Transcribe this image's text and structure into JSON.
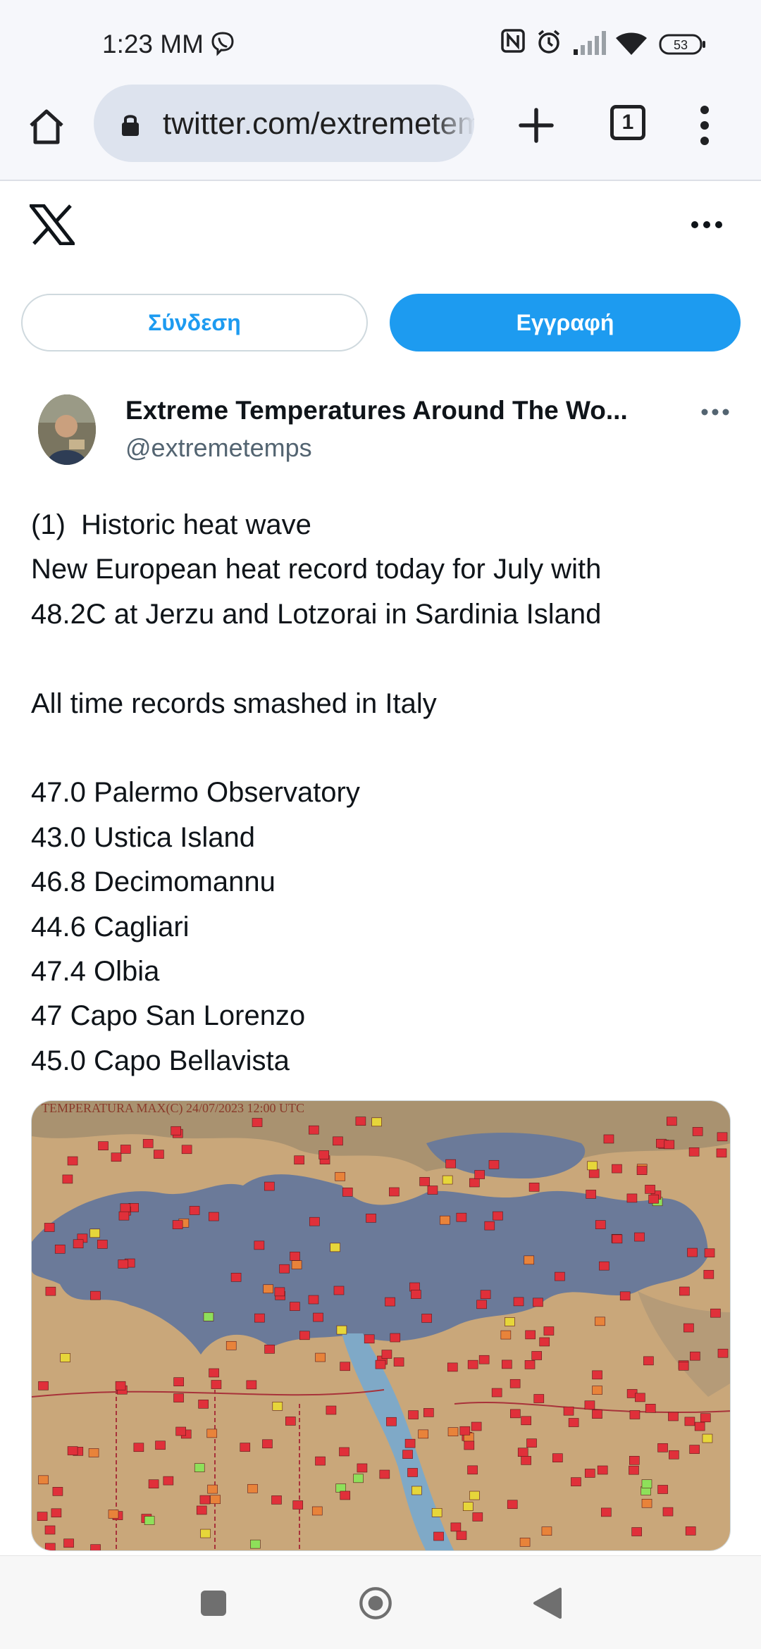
{
  "status_bar": {
    "time": "1:23 MM",
    "battery": "53"
  },
  "browser": {
    "url": "twitter.com/extremetemps",
    "tab_count": "1"
  },
  "x_header": {
    "login_label": "Σύνδεση",
    "signup_label": "Εγγραφή"
  },
  "tweet": {
    "author_name": "Extreme Temperatures Around The Wo...",
    "author_handle": "@extremetemps",
    "text": "(1)  Historic heat wave\nNew European heat record today for July with\n48.2C at Jerzu and Lotzorai in Sardinia Island\n\nAll time records smashed in Italy\n\n47.0 Palermo Observatory\n43.0 Ustica Island\n46.8 Decimomannu\n44.6 Cagliari\n47.4 Olbia\n47 Capo San Lorenzo\n45.0 Capo Bellavista",
    "media_title": "TEMPERATURA MAX(C)   24/07/2023 12:00 UTC"
  },
  "colors": {
    "accent": "#1d9bf0",
    "text": "#0f1419",
    "secondary_text": "#536471",
    "station_marker": "#e0303a",
    "sea": "#6b7a99",
    "land": "#c9a77a"
  }
}
